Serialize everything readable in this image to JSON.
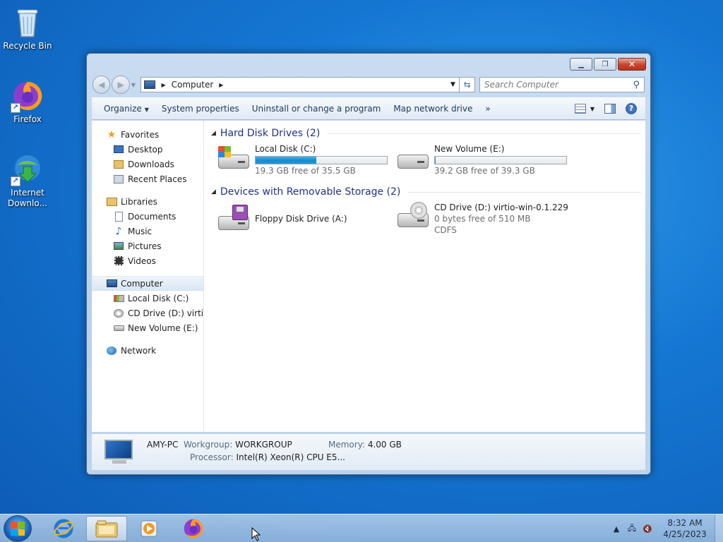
{
  "desktop": {
    "icons": [
      {
        "label": "Recycle Bin",
        "icon": "recycle-bin-icon"
      },
      {
        "label": "Firefox",
        "icon": "firefox-icon"
      },
      {
        "label": "Internet Downlo...",
        "icon": "internet-download-manager-icon"
      }
    ]
  },
  "window": {
    "controls": {
      "minimize": "▁",
      "maximize": "❐",
      "close": "✕"
    },
    "nav": {
      "back": "◀",
      "forward": "▶"
    },
    "address": {
      "crumb": "Computer"
    },
    "search": {
      "placeholder": "Search Computer"
    },
    "toolbar": {
      "organize": "Organize",
      "system_properties": "System properties",
      "uninstall": "Uninstall or change a program",
      "map_drive": "Map network drive",
      "more": "»"
    },
    "sidebar": {
      "favorites": {
        "label": "Favorites",
        "items": [
          "Desktop",
          "Downloads",
          "Recent Places"
        ]
      },
      "libraries": {
        "label": "Libraries",
        "items": [
          "Documents",
          "Music",
          "Pictures",
          "Videos"
        ]
      },
      "computer": {
        "label": "Computer",
        "items": [
          "Local Disk (C:)",
          "CD Drive (D:) virtio-w",
          "New Volume (E:)"
        ]
      },
      "network": {
        "label": "Network"
      }
    },
    "content": {
      "hdd_group": "Hard Disk Drives (2)",
      "removable_group": "Devices with Removable Storage (2)",
      "drives": {
        "c": {
          "name": "Local Disk (C:)",
          "free": "19.3 GB free of 35.5 GB",
          "used_fraction": 0.46
        },
        "e": {
          "name": "New Volume (E:)",
          "free": "39.2 GB free of 39.3 GB",
          "used_fraction": 0.003
        },
        "a": {
          "name": "Floppy Disk Drive (A:)"
        },
        "d": {
          "name": "CD Drive (D:) virtio-win-0.1.229",
          "free": "0 bytes free of 510 MB",
          "fs": "CDFS"
        }
      }
    },
    "details": {
      "name": "AMY-PC",
      "workgroup_label": "Workgroup:",
      "workgroup": "WORKGROUP",
      "memory_label": "Memory:",
      "memory": "4.00 GB",
      "processor_label": "Processor:",
      "processor": "Intel(R) Xeon(R) CPU E5..."
    }
  },
  "taskbar": {
    "clock": {
      "time": "8:32 AM",
      "date": "4/25/2023"
    },
    "tray": {
      "expand": "▲"
    }
  },
  "colors": {
    "accent": "#1e3287",
    "bar_fill": "#1b88c7"
  }
}
